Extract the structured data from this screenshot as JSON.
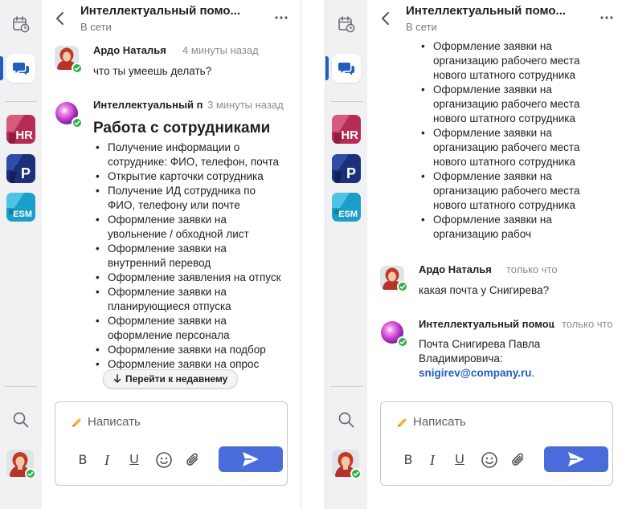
{
  "colors": {
    "accent": "#1f5fbf",
    "send_button": "#4a6cdb",
    "online": "#2fb14b",
    "rail_background": "#f1f1f3",
    "hr_badge": "#b52c55",
    "p_badge": "#1c2f7a",
    "esm_badge": "#1aa0c8"
  },
  "icons": {
    "calendar": "calendar-clock-icon",
    "chat": "chat-bubbles-icon",
    "search": "search-icon",
    "back": "chevron-left-icon",
    "more": "more-horizontal-icon",
    "pencil": "pencil-icon",
    "emoji": "smiley-icon",
    "attach": "paperclip-icon",
    "send": "send-icon",
    "arrow": "arrow-down-icon"
  },
  "rail": {
    "apps": [
      {
        "label": "HR"
      },
      {
        "label": "P"
      },
      {
        "label": "ESM"
      }
    ]
  },
  "header": {
    "title": "Интеллектуальный помо...",
    "status": "В сети"
  },
  "left": {
    "messages": [
      {
        "author": "Ардо Наталья",
        "time": "4 минуты назад",
        "text": "что ты умеешь делать?"
      },
      {
        "author": "Интеллектуальный помощник",
        "time": "3 минуты назад",
        "heading": "Работа с сотрудниками",
        "items": [
          "Получение информации о сотруднике: ФИО, телефон, почта",
          "Открытие карточки сотрудника",
          "Получение ИД сотрудника по ФИО, телефону или почте",
          "Оформление заявки на увольнение / обходной лист",
          "Оформление заявки на внутренний перевод",
          "Оформление заявления на отпуск",
          "Оформление заявки на планирующиеся отпуска",
          "Оформление заявки на оформление персонала",
          "Оформление заявки на подбор",
          "Оформление заявки на опрос"
        ]
      }
    ],
    "jump_label": "Перейти к недавнему"
  },
  "right": {
    "stream_items": [
      "Оформление заявки на организацию рабочего места нового штатного сотрудника",
      "Оформление заявки на организацию рабочего места нового штатного сотрудника",
      "Оформление заявки на организацию рабочего места нового штатного сотрудника",
      "Оформление заявки на организацию рабочего места нового штатного сотрудника",
      "Оформление заявки на организацию рабоч"
    ],
    "messages": [
      {
        "author": "Ардо Наталья",
        "time": "только что",
        "text": "какая почта у Снигирева?"
      },
      {
        "author": "Интеллектуальный помощник",
        "time": "только что",
        "text": "Почта Снигирева Павла Владимировича:",
        "email": "snigirev@company.ru",
        "suffix": "."
      }
    ]
  },
  "composer": {
    "placeholder": "Написать",
    "bold": "B",
    "italic": "I",
    "underline": "U"
  }
}
